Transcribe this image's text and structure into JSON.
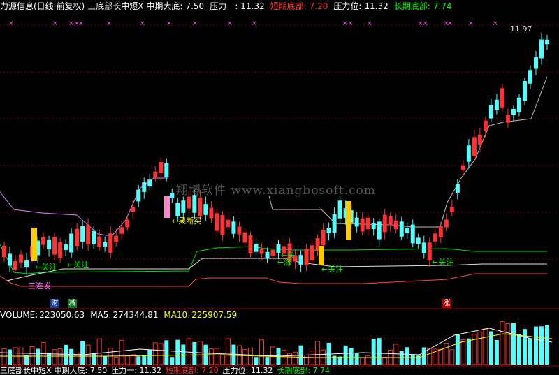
{
  "header": {
    "title": "力源信息(日线 前复权)",
    "indicator": "三底部长中短X",
    "mid_bottom_label": "中期大底:",
    "mid_bottom_value": "7.50",
    "pressure1_label": "压力一:",
    "pressure1_value": "11.32",
    "short_bottom_label": "短期底部:",
    "short_bottom_value": "7.20",
    "pressure_label": "压力位:",
    "pressure_value": "11.32",
    "long_bottom_label": "长期底部:",
    "long_bottom_value": "7.74"
  },
  "price_label": "11.97",
  "watermark": "翔博软件 www.xiangbosoft.com",
  "annotations": {
    "guanzhu": "←关注",
    "guoduan": "←果断买",
    "sanlianfa": "三连发",
    "zhang_tag": "←涨",
    "guanzhu_partial": "←关"
  },
  "badges": {
    "cai": "财",
    "jian": "减",
    "zhang": "涨"
  },
  "volume": {
    "label": "VOLUME:",
    "value": "223050.63",
    "ma5_label": "MA5:",
    "ma5_value": "274344.81",
    "ma10_label": "MA10:",
    "ma10_value": "225907.59"
  },
  "footer": {
    "indicator": "三底部长中短X",
    "mid_bottom": "中期大底: 7.50",
    "pressure1": "压力一: 11.32",
    "short_bottom": "短期底部: 7.20",
    "pressure": "压力位: 11.32",
    "long_bottom": "长期底部: 7.74"
  },
  "colors": {
    "bg": "#000000",
    "up": "#ff3232",
    "down": "#54ffff",
    "mid_line": "#ff5555",
    "short_line": "#ff4545",
    "long_line": "#00dd00",
    "grid": "#7a0000",
    "header_white": "#ffffff",
    "yellow": "#ffff00",
    "magenta": "#ff55ff",
    "green_text": "#00ff00",
    "red_text": "#ff3232"
  }
}
